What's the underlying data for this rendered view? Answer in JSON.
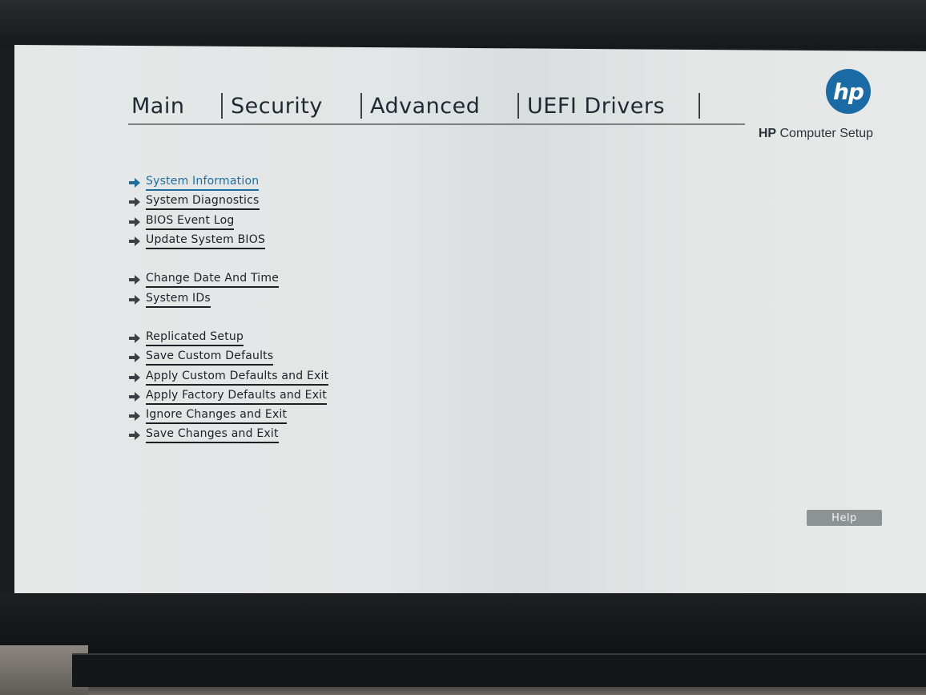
{
  "tabs": [
    {
      "label": "Main"
    },
    {
      "label": "Security"
    },
    {
      "label": "Advanced"
    },
    {
      "label": "UEFI Drivers"
    }
  ],
  "brand": {
    "logo_text": "hp",
    "product_bold": "HP",
    "product_rest": " Computer Setup",
    "logo_color": "#1a6aa6"
  },
  "menu": {
    "group1": [
      {
        "label": "System Information",
        "icon": "arrow-right-icon",
        "selected": true
      },
      {
        "label": "System Diagnostics",
        "icon": "arrow-right-icon"
      },
      {
        "label": "BIOS Event Log",
        "icon": "arrow-right-icon"
      },
      {
        "label": "Update System BIOS",
        "icon": "arrow-right-icon"
      }
    ],
    "group2": [
      {
        "label": "Change Date And Time",
        "icon": "arrow-right-icon"
      },
      {
        "label": "System IDs",
        "icon": "arrow-right-icon"
      }
    ],
    "group3": [
      {
        "label": "Replicated Setup",
        "icon": "arrow-right-icon"
      },
      {
        "label": "Save Custom Defaults",
        "icon": "arrow-right-icon"
      },
      {
        "label": "Apply Custom Defaults and Exit",
        "icon": "arrow-right-icon"
      },
      {
        "label": "Apply Factory Defaults and Exit",
        "icon": "arrow-right-icon"
      },
      {
        "label": "Ignore Changes and Exit",
        "icon": "arrow-right-icon"
      },
      {
        "label": "Save Changes and Exit",
        "icon": "arrow-right-icon"
      }
    ]
  },
  "help": {
    "label": "Help"
  },
  "colors": {
    "selected": "#1d6e9e",
    "text": "#1b2126",
    "help_bg": "#8d9294"
  }
}
